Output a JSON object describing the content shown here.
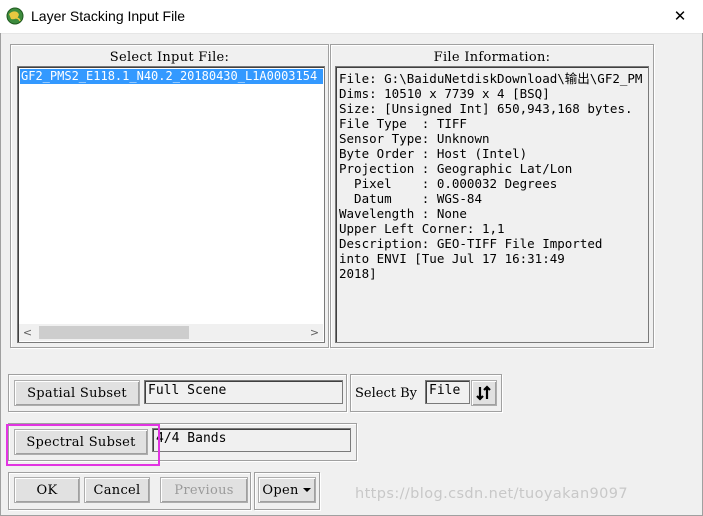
{
  "window": {
    "title": "Layer Stacking Input File",
    "icon": "envi-globe-icon",
    "close_symbol": "✕"
  },
  "input_panel": {
    "title": "Select Input File:",
    "files": [
      "GF2_PMS2_E118.1_N40.2_20180430_L1A0003154"
    ],
    "scroll_left": "<",
    "scroll_right": ">"
  },
  "info_panel": {
    "title": "File Information:",
    "lines": [
      "File: G:\\BaiduNetdiskDownload\\输出\\GF2_PM",
      "Dims: 10510 x 7739 x 4 [BSQ]",
      "Size: [Unsigned Int] 650,943,168 bytes.",
      "File Type  : TIFF",
      "Sensor Type: Unknown",
      "Byte Order : Host (Intel)",
      "Projection : Geographic Lat/Lon",
      "  Pixel    : 0.000032 Degrees",
      "  Datum    : WGS-84",
      "Wavelength : None",
      "Upper Left Corner: 1,1",
      "Description: GEO-TIFF File Imported",
      "into ENVI [Tue Jul 17 16:31:49",
      "2018]"
    ]
  },
  "spatial_subset": {
    "button": "Spatial Subset",
    "value": "Full Scene"
  },
  "select_by": {
    "label": "Select By",
    "value": "File",
    "sort_icon": "sort-arrows-icon"
  },
  "spectral_subset": {
    "button": "Spectral Subset",
    "value": "4/4 Bands"
  },
  "actions": {
    "ok": "OK",
    "cancel": "Cancel",
    "previous": "Previous",
    "open": "Open"
  },
  "watermark": "https://blog.csdn.net/tuoyakan9097",
  "colors": {
    "selection": "#3399ff",
    "highlight": "#e234e2"
  }
}
